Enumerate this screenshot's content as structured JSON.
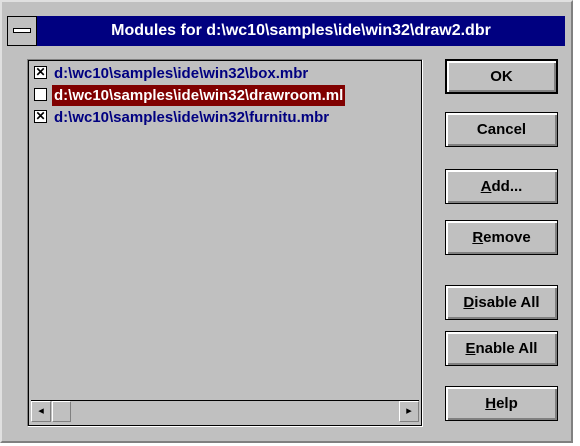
{
  "window": {
    "title": "Modules for d:\\wc10\\samples\\ide\\win32\\draw2.dbr"
  },
  "modules": [
    {
      "checked": true,
      "selected": false,
      "path": "d:\\wc10\\samples\\ide\\win32\\box.mbr"
    },
    {
      "checked": false,
      "selected": true,
      "path": "d:\\wc10\\samples\\ide\\win32\\drawroom.ml"
    },
    {
      "checked": true,
      "selected": false,
      "path": "d:\\wc10\\samples\\ide\\win32\\furnitu.mbr"
    }
  ],
  "scroll": {
    "left_arrow": "◂",
    "right_arrow": "▸"
  },
  "buttons": {
    "ok": "OK",
    "cancel": "Cancel",
    "add": {
      "mnemonic": "A",
      "rest": "dd..."
    },
    "remove": {
      "mnemonic": "R",
      "rest": "emove"
    },
    "disable_all": {
      "mnemonic": "D",
      "rest": "isable All"
    },
    "enable_all": {
      "mnemonic": "E",
      "rest": "nable All"
    },
    "help": {
      "mnemonic": "H",
      "rest": "elp"
    }
  },
  "colors": {
    "titlebar": "#000080",
    "selection": "#800000",
    "item_text": "#000080",
    "face": "#c0c0c0"
  },
  "icons": {
    "system_menu": "system-menu-icon",
    "checkbox_checked": "✕"
  }
}
